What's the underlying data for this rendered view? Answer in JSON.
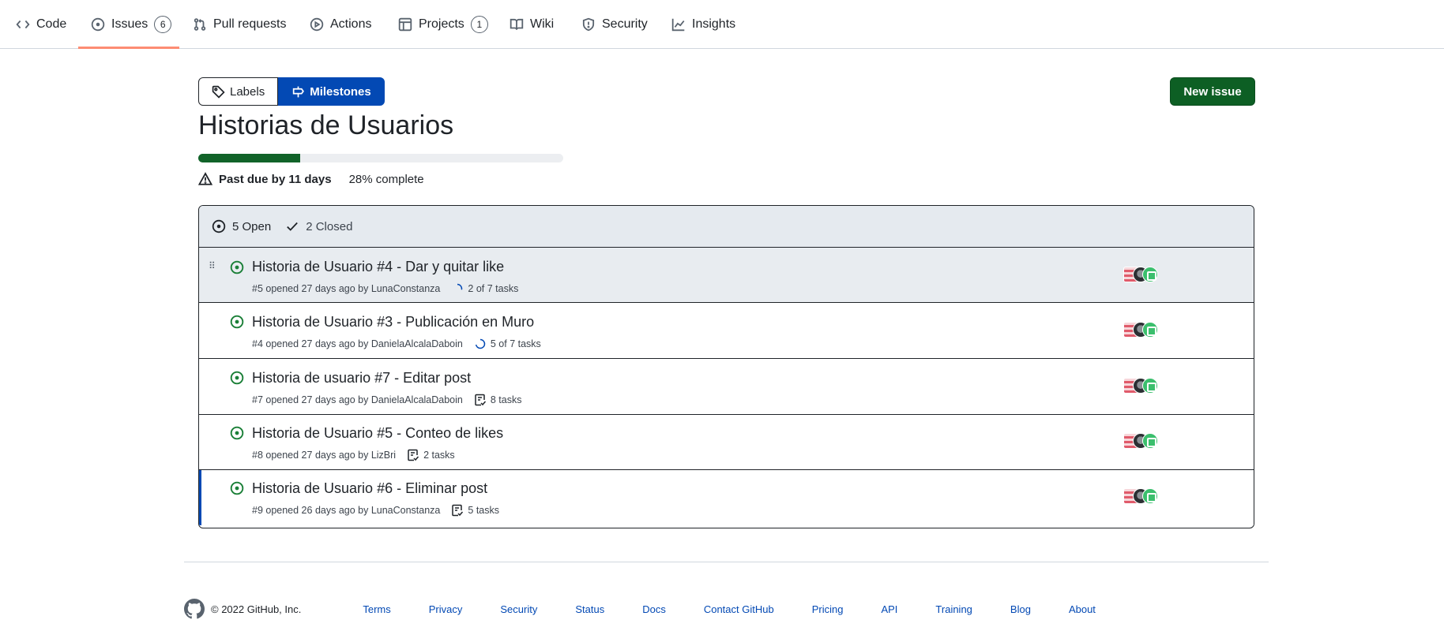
{
  "repo_nav": {
    "tabs": [
      {
        "label": "Code",
        "icon": "code-icon"
      },
      {
        "label": "Issues",
        "icon": "issue-opened-icon",
        "count": "6",
        "selected": true
      },
      {
        "label": "Pull requests",
        "icon": "git-pull-request-icon"
      },
      {
        "label": "Actions",
        "icon": "play-icon"
      },
      {
        "label": "Projects",
        "icon": "table-icon",
        "count": "1"
      },
      {
        "label": "Wiki",
        "icon": "book-icon"
      },
      {
        "label": "Security",
        "icon": "shield-icon"
      },
      {
        "label": "Insights",
        "icon": "graph-icon"
      }
    ]
  },
  "subnav": {
    "labels": "Labels",
    "milestones": "Milestones"
  },
  "new_issue_label": "New issue",
  "milestone": {
    "title": "Historias de Usuarios",
    "progress_percent": 28,
    "past_due": "Past due by 11 days",
    "complete": "28% complete"
  },
  "states": {
    "open": "5 Open",
    "closed": "2 Closed"
  },
  "issues": [
    {
      "title": "Historia de Usuario #4 - Dar y quitar like",
      "meta": "#5 opened 27 days ago by LunaConstanza",
      "tasks": "2 of 7 tasks",
      "task_type": "progress",
      "task_fraction": 0.2857
    },
    {
      "title": "Historia de Usuario #3 - Publicación en Muro",
      "meta": "#4 opened 27 days ago by DanielaAlcalaDaboin",
      "tasks": "5 of 7 tasks",
      "task_type": "progress",
      "task_fraction": 0.7143
    },
    {
      "title": "Historia de usuario #7 - Editar post",
      "meta": "#7 opened 27 days ago by DanielaAlcalaDaboin",
      "tasks": "8 tasks",
      "task_type": "checklist"
    },
    {
      "title": "Historia de Usuario #5 - Conteo de likes",
      "meta": "#8 opened 27 days ago by LizBri",
      "tasks": "2 tasks",
      "task_type": "checklist"
    },
    {
      "title": "Historia de Usuario #6 - Eliminar post",
      "meta": "#9 opened 26 days ago by LunaConstanza",
      "tasks": "5 tasks",
      "task_type": "checklist"
    }
  ],
  "footer": {
    "copyright": "© 2022 GitHub, Inc.",
    "links": [
      "Terms",
      "Privacy",
      "Security",
      "Status",
      "Docs",
      "Contact GitHub",
      "Pricing",
      "API",
      "Training",
      "Blog",
      "About"
    ]
  },
  "colors": {
    "accent_blue": "#0349b4",
    "success_green": "#1a7f37",
    "tab_underline": "#fd8c73"
  }
}
